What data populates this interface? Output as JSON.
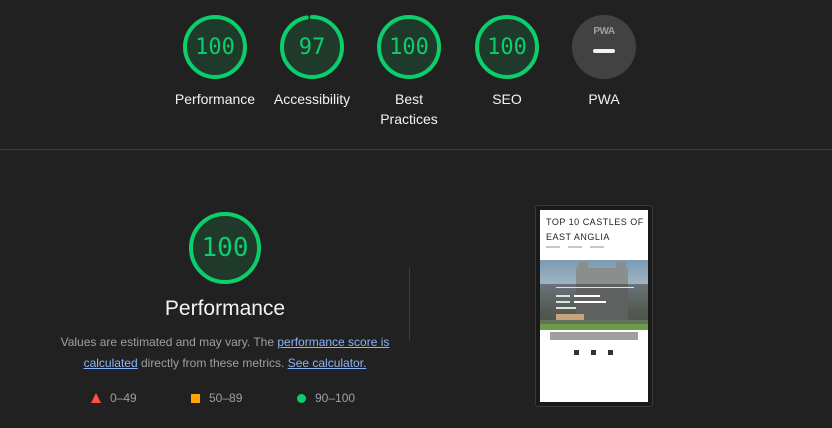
{
  "categories": [
    {
      "score": "100",
      "label": "Performance",
      "fraction": 1.0
    },
    {
      "score": "97",
      "label": "Accessibility",
      "fraction": 0.97
    },
    {
      "score": "100",
      "label": "Best Practices",
      "fraction": 1.0
    },
    {
      "score": "100",
      "label": "SEO",
      "fraction": 1.0
    }
  ],
  "pwa": {
    "badge_text": "PWA",
    "label": "PWA"
  },
  "main": {
    "score": "100",
    "fraction": 1.0,
    "title": "Performance",
    "desc_prefix": "Values are estimated and may vary. The ",
    "link_score": "performance score is calculated",
    "desc_middle": " directly from these metrics. ",
    "link_calc": "See calculator."
  },
  "legend": {
    "fail": "0–49",
    "average": "50–89",
    "pass": "90–100"
  },
  "thumbnail": {
    "site_title": "TOP 10 CASTLES OF EAST ANGLIA"
  },
  "colors": {
    "pass": "#0cce6b",
    "average": "#ffa400",
    "fail": "#ff4e42",
    "link": "#8ab4f8"
  }
}
